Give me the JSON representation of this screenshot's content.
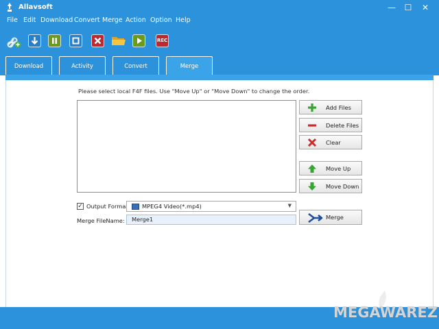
{
  "window": {
    "title": "Allavsoft",
    "minimize": "—",
    "maximize": "☐",
    "close": "✕"
  },
  "menu": [
    "File",
    "Edit",
    "Download",
    "Convert",
    "Merge",
    "Action",
    "Option",
    "Help"
  ],
  "toolbar": {
    "rec_label": "REC"
  },
  "tabs": [
    {
      "label": "Download"
    },
    {
      "label": "Activity"
    },
    {
      "label": "Convert"
    },
    {
      "label": "Merge"
    }
  ],
  "merge": {
    "instruction": "Please select local F4F files. Use \"Move Up\" or \"Move Down\" to change the order.",
    "buttons": {
      "add_files": "Add Files",
      "delete_files": "Delete Files",
      "clear": "Clear",
      "move_up": "Move Up",
      "move_down": "Move Down",
      "merge": "Merge"
    },
    "output_format_checked": true,
    "output_format_label": "Output Format:",
    "output_format_value": "MPEG4 Video(*.mp4)",
    "merge_filename_label": "Merge FileName:",
    "merge_filename_value": "Merge1"
  },
  "watermark": "MEGAWAREZ",
  "colors": {
    "accent": "#2c92db",
    "tab_active": "#3ba4e9"
  }
}
